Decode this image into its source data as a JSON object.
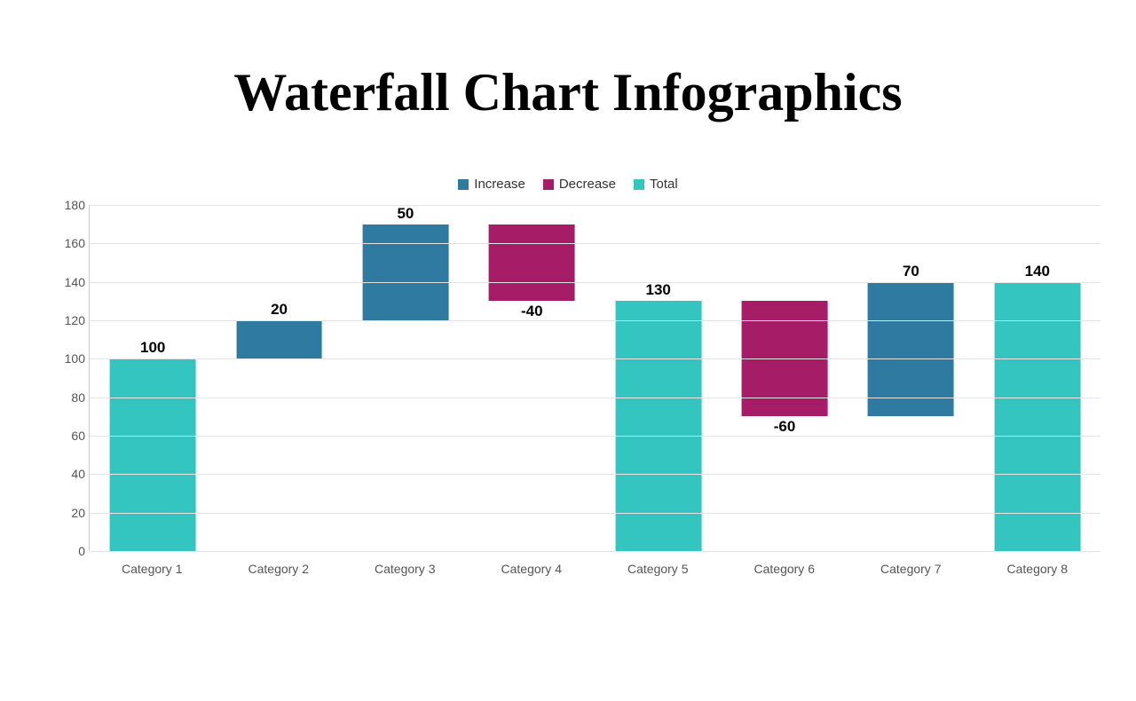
{
  "title": "Waterfall Chart Infographics",
  "legend": {
    "increase": "Increase",
    "decrease": "Decrease",
    "total": "Total"
  },
  "colors": {
    "increase": "#2e7aa1",
    "decrease": "#a71c67",
    "total": "#34c5c0"
  },
  "chart_data": {
    "type": "bar",
    "subtype": "waterfall",
    "categories": [
      "Category 1",
      "Category 2",
      "Category 3",
      "Category 4",
      "Category 5",
      "Category 6",
      "Category 7",
      "Category 8"
    ],
    "values": [
      100,
      20,
      50,
      -40,
      130,
      -60,
      70,
      140
    ],
    "bar_types": [
      "total",
      "increase",
      "increase",
      "decrease",
      "total",
      "decrease",
      "increase",
      "total"
    ],
    "bar_bottoms": [
      0,
      100,
      120,
      130,
      0,
      70,
      70,
      0
    ],
    "bar_tops": [
      100,
      120,
      170,
      170,
      130,
      130,
      140,
      140
    ],
    "label_positions": [
      "top",
      "top",
      "top",
      "bottom",
      "top",
      "bottom",
      "top",
      "top"
    ],
    "title": "Waterfall Chart Infographics",
    "xlabel": "",
    "ylabel": "",
    "ylim": [
      0,
      180
    ],
    "yticks": [
      0,
      20,
      40,
      60,
      80,
      100,
      120,
      140,
      160,
      180
    ]
  }
}
